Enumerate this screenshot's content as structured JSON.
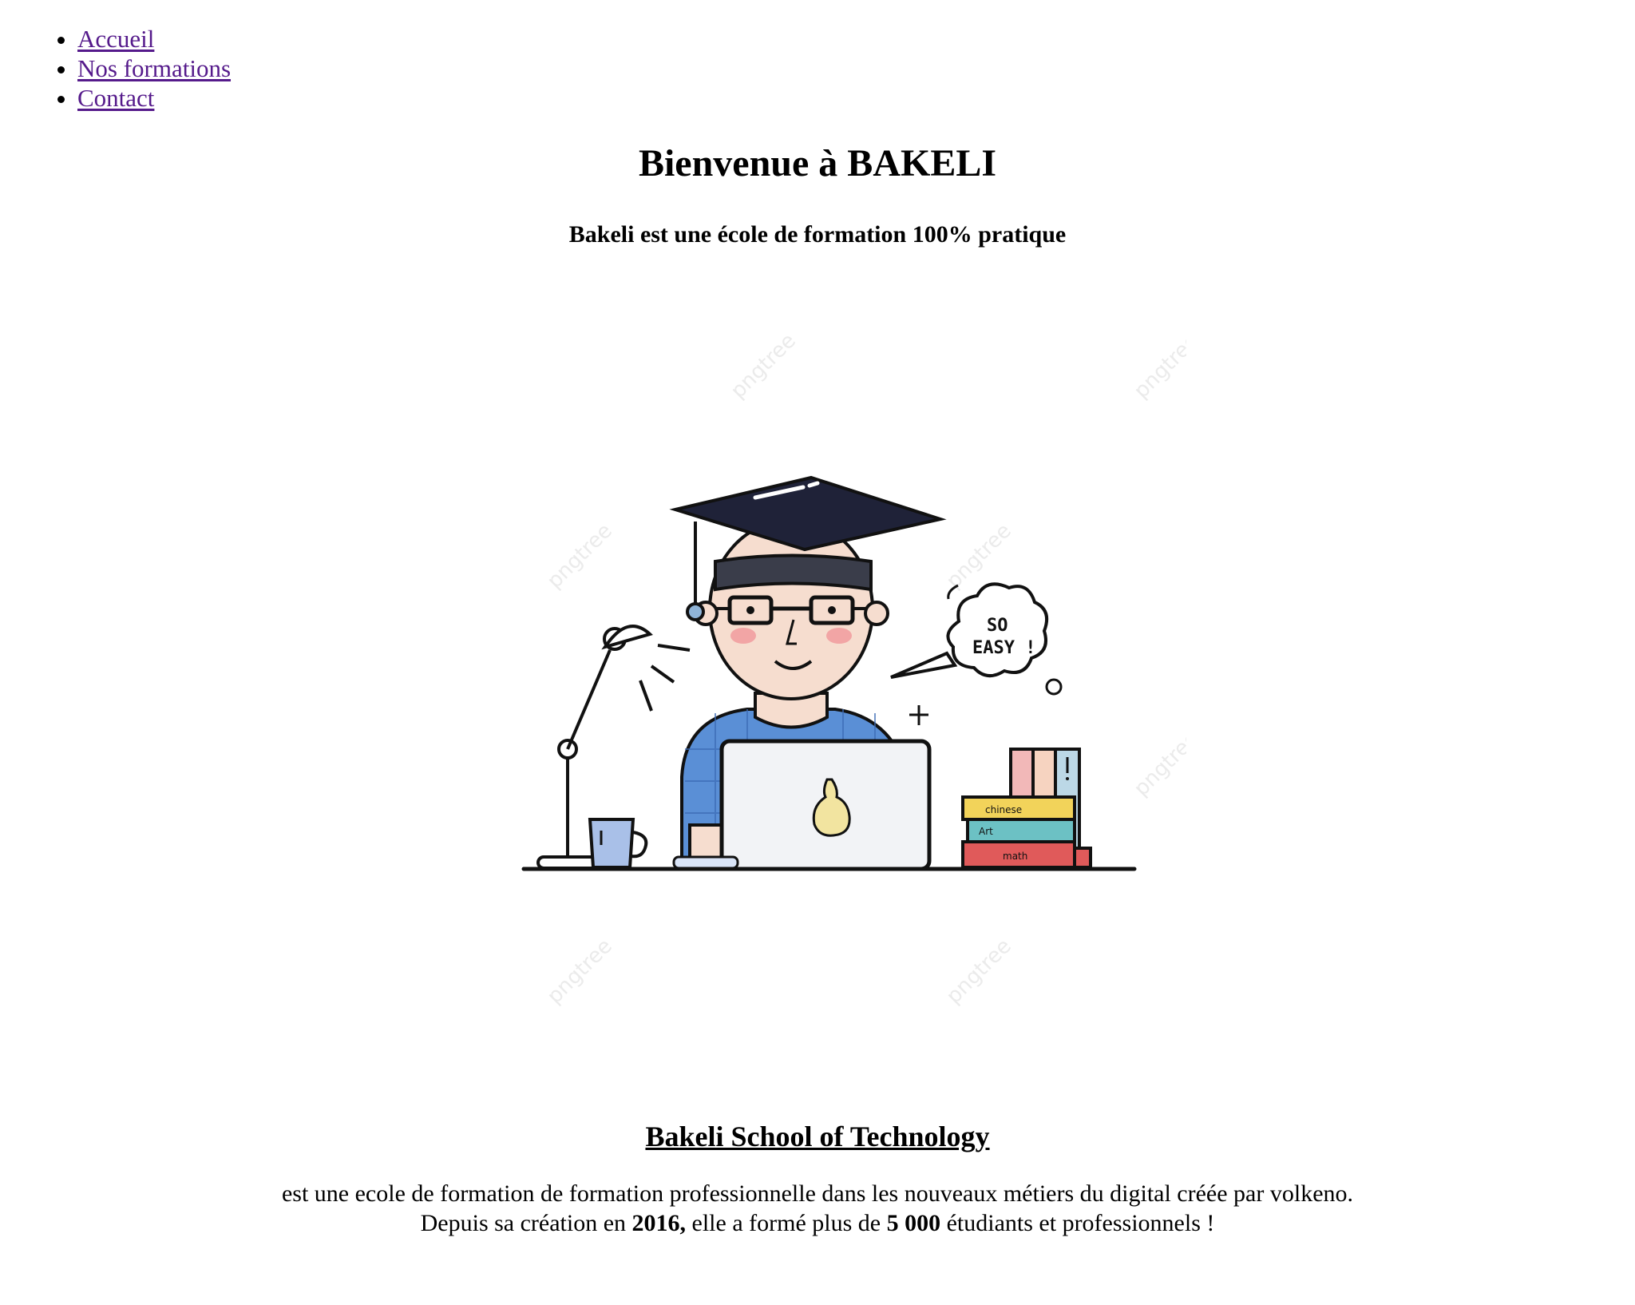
{
  "nav": {
    "items": [
      {
        "label": "Accueil"
      },
      {
        "label": "Nos formations"
      },
      {
        "label": "Contact"
      }
    ]
  },
  "hero": {
    "title": "Bienvenue à BAKELI",
    "subtitle": "Bakeli est une école de formation 100% pratique",
    "illustration": {
      "bubble_line1": "SO",
      "bubble_line2": "EASY !",
      "book_labels": [
        "chinese",
        "Art",
        "math"
      ],
      "watermark": "pngtree"
    }
  },
  "about": {
    "heading": "Bakeli School of Technology",
    "line1": "est une ecole de formation de formation professionnelle dans les nouveaux métiers du digital créée par volkeno.",
    "line2_prefix": "Depuis sa création en ",
    "year": "2016,",
    "line2_middle": " elle a formé plus de ",
    "count": "5 000",
    "line2_suffix": " étudiants et professionnels !"
  },
  "colors": {
    "link_visited": "#551a8b",
    "text": "#000000",
    "background": "#ffffff"
  }
}
